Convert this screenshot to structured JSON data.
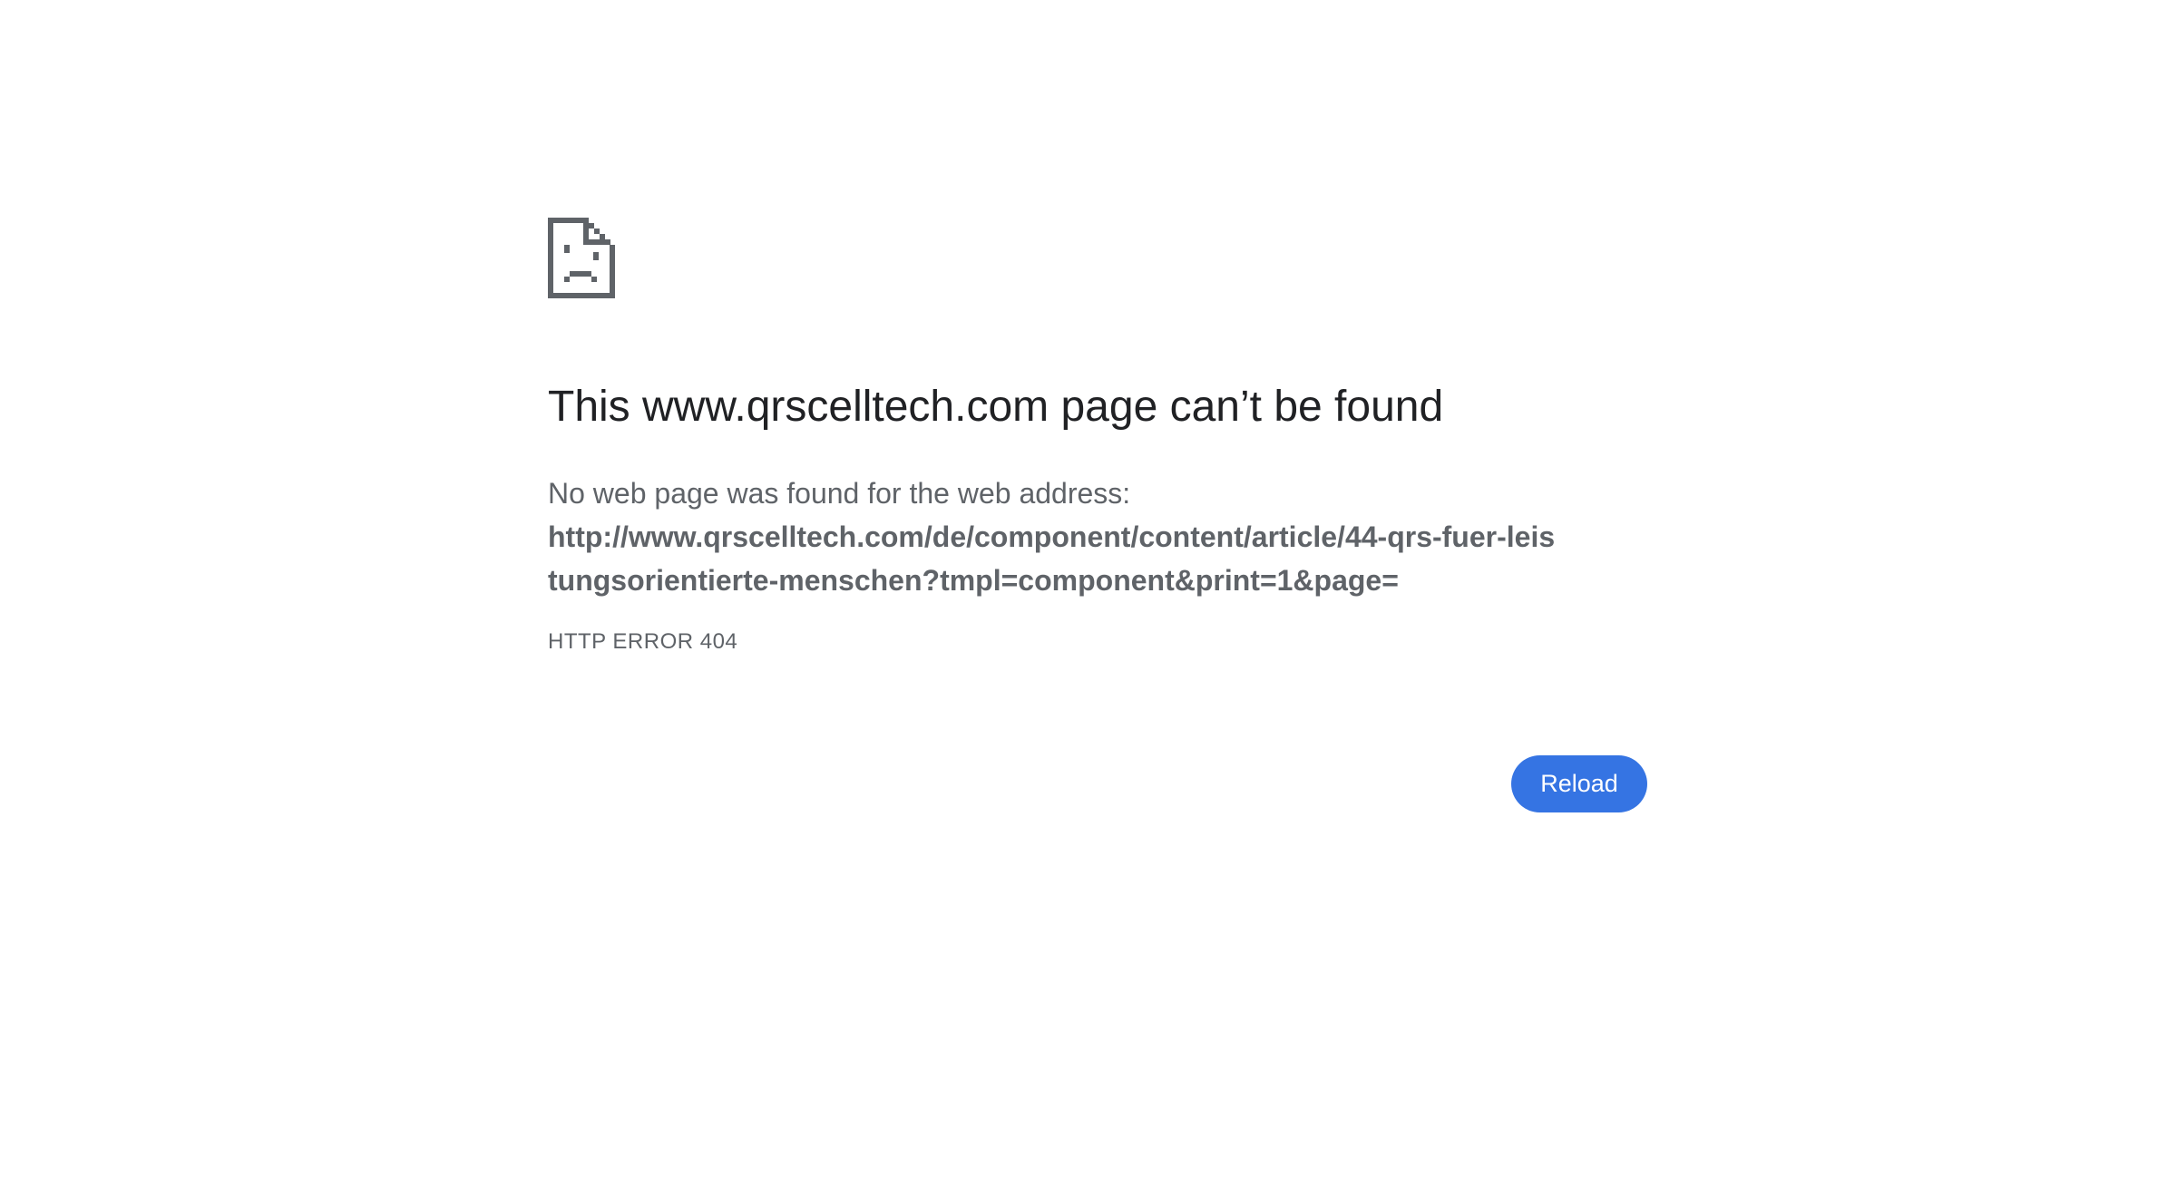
{
  "error_page": {
    "icon": "sad-document-icon",
    "heading": "This www.qrscelltech.com page can’t be found",
    "summary_prefix": "No web page was found for the web address:",
    "url": "http://www.qrscelltech.com/de/component/content/article/44-qrs-fuer-leistungsorientierte-menschen?tmpl=component&print=1&page=",
    "error_code": "HTTP ERROR 404",
    "reload_label": "Reload"
  },
  "colors": {
    "heading": "#202124",
    "body_text": "#5f6368",
    "icon": "#5f6368",
    "button_bg": "#3574e3",
    "button_text": "#ffffff",
    "background": "#ffffff"
  }
}
